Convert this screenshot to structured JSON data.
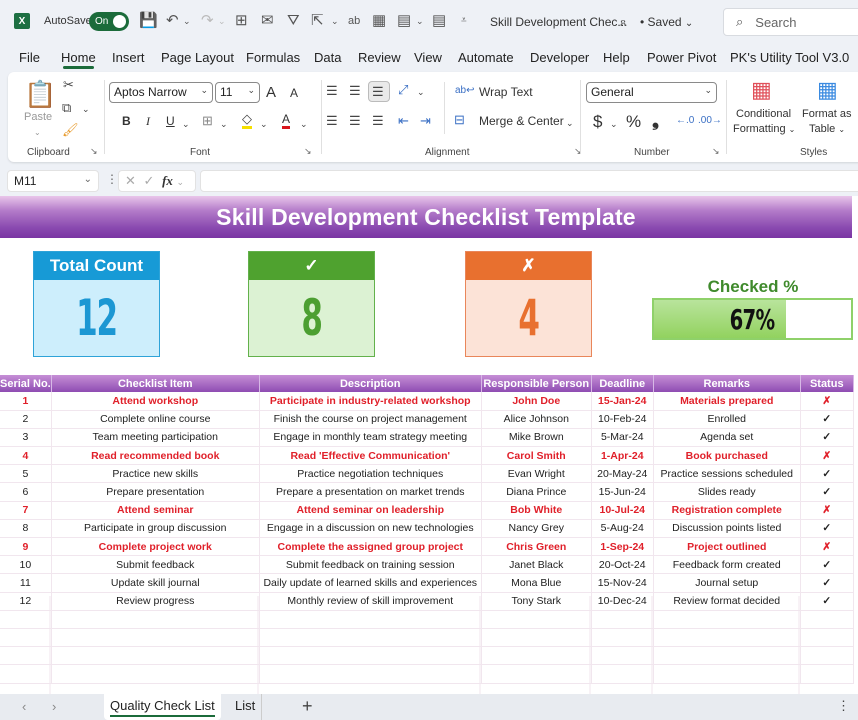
{
  "titlebar": {
    "app_icon": "excel-icon",
    "autosave_label": "AutoSave",
    "autosave_state": "On",
    "doc_title": "Skill Development Chec...",
    "saved_status": "• Saved",
    "search_placeholder": "Search"
  },
  "menu": {
    "tabs": [
      "File",
      "Home",
      "Insert",
      "Page Layout",
      "Formulas",
      "Data",
      "Review",
      "View",
      "Automate",
      "Developer",
      "Help",
      "Power Pivot",
      "PK's Utility Tool V3.0"
    ],
    "active": "Home"
  },
  "ribbon": {
    "clipboard": {
      "label": "Clipboard",
      "paste": "Paste"
    },
    "font": {
      "label": "Font",
      "font_name": "Aptos Narrow",
      "font_size": "11",
      "bold": "B",
      "italic": "I",
      "underline": "U",
      "grow": "A",
      "shrink": "A",
      "font_color_letter": "A"
    },
    "alignment": {
      "label": "Alignment",
      "wrap_text": "Wrap Text",
      "merge_center": "Merge & Center"
    },
    "number": {
      "label": "Number",
      "format": "General",
      "currency": "$",
      "percent": "%",
      "comma": "❟"
    },
    "styles": {
      "label": "Styles",
      "conditional_1": "Conditional",
      "conditional_2": "Formatting",
      "format_table_1": "Format as",
      "format_table_2": "Table"
    }
  },
  "formula_bar": {
    "name_box": "M11",
    "fx": "fx",
    "formula": ""
  },
  "sheet": {
    "title": "Skill Development Checklist Template",
    "kpis": {
      "total": {
        "label": "Total Count",
        "value": "12"
      },
      "checked": {
        "label": "✓",
        "value": "8"
      },
      "unchecked": {
        "label": "✗",
        "value": "4"
      }
    },
    "checked_pct": {
      "label": "Checked %",
      "value_text": "67%",
      "fraction": 0.67
    },
    "colors": {
      "banner": "#8a4ab0",
      "total": "#179ad6",
      "checked": "#4fa22f",
      "unchecked": "#e8702f",
      "pending_text": "#e0202a",
      "done_mark": "#1fa44a"
    },
    "table": {
      "columns": [
        "Serial No.",
        "Checklist Item",
        "Description",
        "Responsible Person",
        "Deadline",
        "Remarks",
        "Status"
      ],
      "rows": [
        {
          "serial": "1",
          "item": "Attend workshop",
          "description": "Participate in industry-related workshop",
          "person": "John Doe",
          "deadline": "15-Jan-24",
          "remarks": "Materials prepared",
          "status": "✗",
          "done": false
        },
        {
          "serial": "2",
          "item": "Complete online course",
          "description": "Finish the course on project management",
          "person": "Alice Johnson",
          "deadline": "10-Feb-24",
          "remarks": "Enrolled",
          "status": "✓",
          "done": true
        },
        {
          "serial": "3",
          "item": "Team meeting participation",
          "description": "Engage in monthly team strategy meeting",
          "person": "Mike Brown",
          "deadline": "5-Mar-24",
          "remarks": "Agenda set",
          "status": "✓",
          "done": true
        },
        {
          "serial": "4",
          "item": "Read recommended book",
          "description": "Read 'Effective Communication'",
          "person": "Carol Smith",
          "deadline": "1-Apr-24",
          "remarks": "Book purchased",
          "status": "✗",
          "done": false
        },
        {
          "serial": "5",
          "item": "Practice new skills",
          "description": "Practice negotiation techniques",
          "person": "Evan Wright",
          "deadline": "20-May-24",
          "remarks": "Practice sessions scheduled",
          "status": "✓",
          "done": true
        },
        {
          "serial": "6",
          "item": "Prepare presentation",
          "description": "Prepare a presentation on market trends",
          "person": "Diana Prince",
          "deadline": "15-Jun-24",
          "remarks": "Slides ready",
          "status": "✓",
          "done": true
        },
        {
          "serial": "7",
          "item": "Attend seminar",
          "description": "Attend seminar on leadership",
          "person": "Bob White",
          "deadline": "10-Jul-24",
          "remarks": "Registration complete",
          "status": "✗",
          "done": false
        },
        {
          "serial": "8",
          "item": "Participate in group discussion",
          "description": "Engage in a discussion on new technologies",
          "person": "Nancy Grey",
          "deadline": "5-Aug-24",
          "remarks": "Discussion points listed",
          "status": "✓",
          "done": true
        },
        {
          "serial": "9",
          "item": "Complete project work",
          "description": "Complete the assigned group project",
          "person": "Chris Green",
          "deadline": "1-Sep-24",
          "remarks": "Project outlined",
          "status": "✗",
          "done": false
        },
        {
          "serial": "10",
          "item": "Submit feedback",
          "description": "Submit feedback on training session",
          "person": "Janet Black",
          "deadline": "20-Oct-24",
          "remarks": "Feedback form created",
          "status": "✓",
          "done": true
        },
        {
          "serial": "11",
          "item": "Update skill journal",
          "description": "Daily update of learned skills and experiences",
          "person": "Mona Blue",
          "deadline": "15-Nov-24",
          "remarks": "Journal setup",
          "status": "✓",
          "done": true
        },
        {
          "serial": "12",
          "item": "Review progress",
          "description": "Monthly review of skill improvement",
          "person": "Tony Stark",
          "deadline": "10-Dec-24",
          "remarks": "Review format decided",
          "status": "✓",
          "done": true
        }
      ]
    }
  },
  "sheet_tabs": {
    "tabs": [
      "Quality Check List",
      "List"
    ],
    "active": "Quality Check List",
    "add": "+"
  }
}
